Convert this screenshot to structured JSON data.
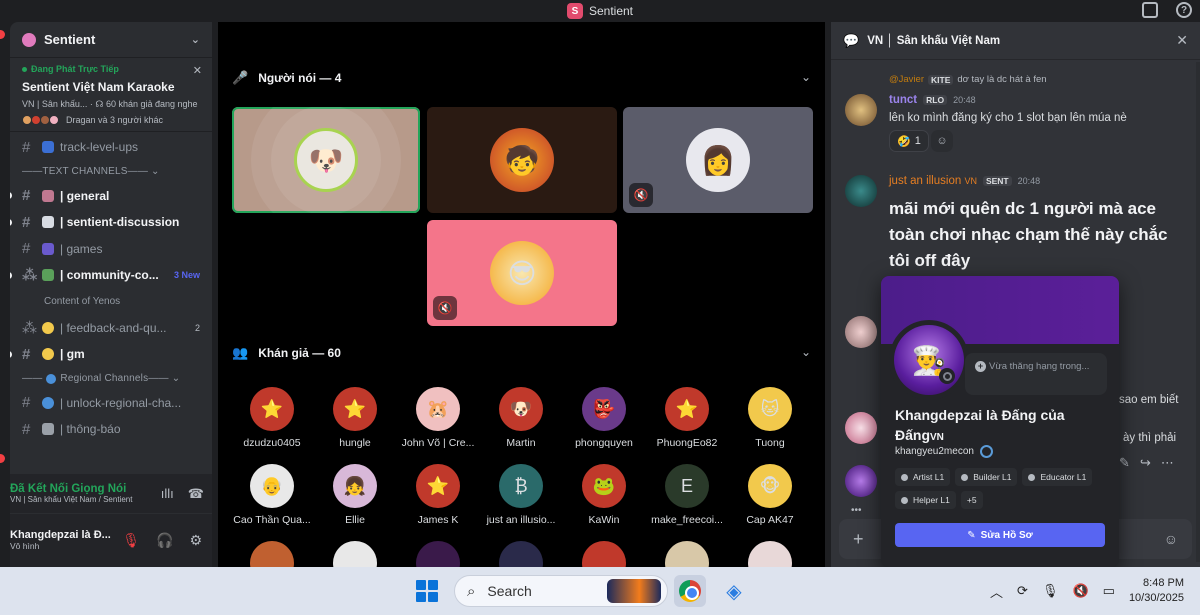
{
  "titlebar": {
    "app_name": "Sentient"
  },
  "sidebar": {
    "server_name": "Sentient",
    "live": {
      "status": "Đang Phát Trực Tiếp",
      "title": "Sentient Việt Nam Karaoke",
      "channel_prefix": "VN",
      "channel": "| Sân khấu...",
      "listeners": "60 khán giả đang nghe",
      "users": "Dragan và 3 người khác"
    },
    "channels": [
      {
        "name": "track-level-ups",
        "prefix": "#",
        "emoji": "UP",
        "bold": false
      },
      {
        "name": "| general",
        "prefix": "#",
        "emoji": "",
        "bold": true
      },
      {
        "name": "| sentient-discussion",
        "prefix": "#",
        "emoji": "",
        "bold": true
      },
      {
        "name": "| games",
        "prefix": "#",
        "emoji": "",
        "bold": false
      },
      {
        "name": "| community-co...",
        "prefix": "#",
        "emoji": "",
        "bold": true,
        "badge": "3 New"
      },
      {
        "name": "| feedback-and-qu...",
        "prefix": "#",
        "emoji": "",
        "bold": false,
        "count": "2"
      },
      {
        "name": "| gm",
        "prefix": "#",
        "emoji": "",
        "bold": true
      },
      {
        "name": "| unlock-regional-cha...",
        "prefix": "#",
        "emoji": "",
        "bold": false
      },
      {
        "name": "| thông-báo",
        "prefix": "#",
        "emoji": "",
        "bold": false
      }
    ],
    "category_text": "TEXT CHANNELS",
    "category_regional": "Regional Channels",
    "sub_item": "Content of Yenos",
    "voice": {
      "connected": "Đã Kết Nối Giọng Nói",
      "channel": "VN | Sân khấu Việt Nam / Sentient",
      "user_name": "Khangdepzai là Đ...",
      "user_status": "Vô hình"
    }
  },
  "stage": {
    "speakers_header": "Người nói — 4",
    "audience_header": "Khán giả — 60",
    "audience": [
      "dzudzu0405",
      "hungle",
      "John Võ | Cre...",
      "Martin",
      "phongquyen",
      "PhuongEo82",
      "Tuong",
      "Cao Thần Qua...",
      "Ellie",
      "James K",
      "just an illusio...",
      "KaWin",
      "make_freecoi...",
      "Cap AK47"
    ]
  },
  "chat": {
    "title": "VN │ Sân khấu Việt Nam",
    "messages": [
      {
        "reply_name": "@Javier",
        "reply_tag": "KITE",
        "reply_text": "dơ tay là dc hát à fen",
        "name": "tunct",
        "tag": "RLO",
        "time": "20:48",
        "text": "lên ko mình đăng ký cho 1 slot bạn lên múa nè",
        "reaction_count": "1"
      },
      {
        "name": "just an illusion",
        "name_suffix": "VN",
        "tag": "SENT",
        "time": "20:48",
        "text": "mãi mới quên dc 1 người mà ace toàn chơi nhạc chạm thế này chắc tôi off đây"
      }
    ],
    "side_fragments": [
      "sao em biết",
      "ày thì phải"
    ]
  },
  "profile": {
    "note_placeholder": "Vừa thăng hạng trong...",
    "display_name": "Khangdepzai là Đấng của Đấng",
    "name_suffix": "VN",
    "username": "khangyeu2mecon",
    "roles": [
      "Artist L1",
      "Builder L1",
      "Educator L1",
      "Helper L1",
      "+5"
    ],
    "edit_button": "Sửa Hồ Sơ"
  },
  "taskbar": {
    "search_label": "Search",
    "time": "8:48 PM",
    "date": "10/30/2025"
  }
}
